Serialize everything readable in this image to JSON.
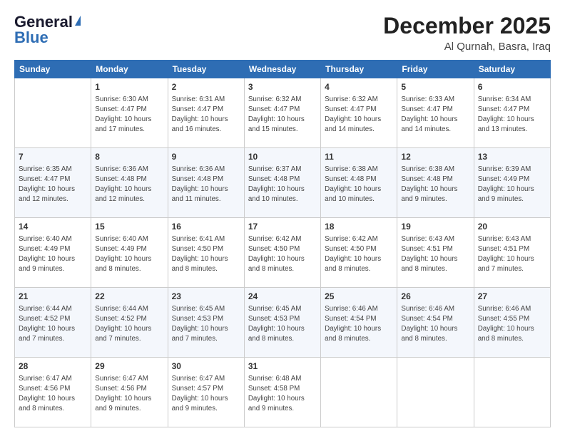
{
  "header": {
    "logo_line1": "General",
    "logo_line2": "Blue",
    "title": "December 2025",
    "subtitle": "Al Qurnah, Basra, Iraq"
  },
  "weekdays": [
    "Sunday",
    "Monday",
    "Tuesday",
    "Wednesday",
    "Thursday",
    "Friday",
    "Saturday"
  ],
  "weeks": [
    [
      {
        "day": "",
        "info": ""
      },
      {
        "day": "1",
        "info": "Sunrise: 6:30 AM\nSunset: 4:47 PM\nDaylight: 10 hours and 17 minutes."
      },
      {
        "day": "2",
        "info": "Sunrise: 6:31 AM\nSunset: 4:47 PM\nDaylight: 10 hours and 16 minutes."
      },
      {
        "day": "3",
        "info": "Sunrise: 6:32 AM\nSunset: 4:47 PM\nDaylight: 10 hours and 15 minutes."
      },
      {
        "day": "4",
        "info": "Sunrise: 6:32 AM\nSunset: 4:47 PM\nDaylight: 10 hours and 14 minutes."
      },
      {
        "day": "5",
        "info": "Sunrise: 6:33 AM\nSunset: 4:47 PM\nDaylight: 10 hours and 14 minutes."
      },
      {
        "day": "6",
        "info": "Sunrise: 6:34 AM\nSunset: 4:47 PM\nDaylight: 10 hours and 13 minutes."
      }
    ],
    [
      {
        "day": "7",
        "info": "Sunrise: 6:35 AM\nSunset: 4:47 PM\nDaylight: 10 hours and 12 minutes."
      },
      {
        "day": "8",
        "info": "Sunrise: 6:36 AM\nSunset: 4:48 PM\nDaylight: 10 hours and 12 minutes."
      },
      {
        "day": "9",
        "info": "Sunrise: 6:36 AM\nSunset: 4:48 PM\nDaylight: 10 hours and 11 minutes."
      },
      {
        "day": "10",
        "info": "Sunrise: 6:37 AM\nSunset: 4:48 PM\nDaylight: 10 hours and 10 minutes."
      },
      {
        "day": "11",
        "info": "Sunrise: 6:38 AM\nSunset: 4:48 PM\nDaylight: 10 hours and 10 minutes."
      },
      {
        "day": "12",
        "info": "Sunrise: 6:38 AM\nSunset: 4:48 PM\nDaylight: 10 hours and 9 minutes."
      },
      {
        "day": "13",
        "info": "Sunrise: 6:39 AM\nSunset: 4:49 PM\nDaylight: 10 hours and 9 minutes."
      }
    ],
    [
      {
        "day": "14",
        "info": "Sunrise: 6:40 AM\nSunset: 4:49 PM\nDaylight: 10 hours and 9 minutes."
      },
      {
        "day": "15",
        "info": "Sunrise: 6:40 AM\nSunset: 4:49 PM\nDaylight: 10 hours and 8 minutes."
      },
      {
        "day": "16",
        "info": "Sunrise: 6:41 AM\nSunset: 4:50 PM\nDaylight: 10 hours and 8 minutes."
      },
      {
        "day": "17",
        "info": "Sunrise: 6:42 AM\nSunset: 4:50 PM\nDaylight: 10 hours and 8 minutes."
      },
      {
        "day": "18",
        "info": "Sunrise: 6:42 AM\nSunset: 4:50 PM\nDaylight: 10 hours and 8 minutes."
      },
      {
        "day": "19",
        "info": "Sunrise: 6:43 AM\nSunset: 4:51 PM\nDaylight: 10 hours and 8 minutes."
      },
      {
        "day": "20",
        "info": "Sunrise: 6:43 AM\nSunset: 4:51 PM\nDaylight: 10 hours and 7 minutes."
      }
    ],
    [
      {
        "day": "21",
        "info": "Sunrise: 6:44 AM\nSunset: 4:52 PM\nDaylight: 10 hours and 7 minutes."
      },
      {
        "day": "22",
        "info": "Sunrise: 6:44 AM\nSunset: 4:52 PM\nDaylight: 10 hours and 7 minutes."
      },
      {
        "day": "23",
        "info": "Sunrise: 6:45 AM\nSunset: 4:53 PM\nDaylight: 10 hours and 7 minutes."
      },
      {
        "day": "24",
        "info": "Sunrise: 6:45 AM\nSunset: 4:53 PM\nDaylight: 10 hours and 8 minutes."
      },
      {
        "day": "25",
        "info": "Sunrise: 6:46 AM\nSunset: 4:54 PM\nDaylight: 10 hours and 8 minutes."
      },
      {
        "day": "26",
        "info": "Sunrise: 6:46 AM\nSunset: 4:54 PM\nDaylight: 10 hours and 8 minutes."
      },
      {
        "day": "27",
        "info": "Sunrise: 6:46 AM\nSunset: 4:55 PM\nDaylight: 10 hours and 8 minutes."
      }
    ],
    [
      {
        "day": "28",
        "info": "Sunrise: 6:47 AM\nSunset: 4:56 PM\nDaylight: 10 hours and 8 minutes."
      },
      {
        "day": "29",
        "info": "Sunrise: 6:47 AM\nSunset: 4:56 PM\nDaylight: 10 hours and 9 minutes."
      },
      {
        "day": "30",
        "info": "Sunrise: 6:47 AM\nSunset: 4:57 PM\nDaylight: 10 hours and 9 minutes."
      },
      {
        "day": "31",
        "info": "Sunrise: 6:48 AM\nSunset: 4:58 PM\nDaylight: 10 hours and 9 minutes."
      },
      {
        "day": "",
        "info": ""
      },
      {
        "day": "",
        "info": ""
      },
      {
        "day": "",
        "info": ""
      }
    ]
  ]
}
